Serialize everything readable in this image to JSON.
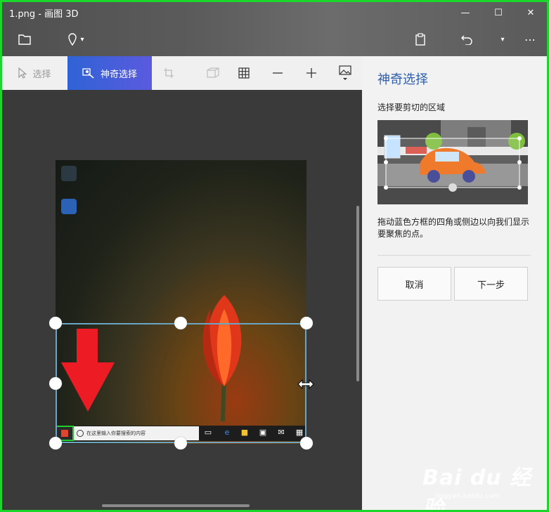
{
  "window": {
    "title": "1.png - 画图 3D",
    "controls": {
      "minimize_icon": "—",
      "maximize_icon": "☐",
      "close_icon": "✕"
    }
  },
  "appbar": {
    "folder_icon": "folder-icon",
    "pin_icon": "pin-icon",
    "pin_dropdown": "▾",
    "paste_icon": "paste-icon",
    "undo_icon": "undo-icon",
    "history_dropdown": "▾",
    "more": "⋯"
  },
  "toolbar": {
    "select_label": "选择",
    "magic_select_label": "神奇选择",
    "tools": [
      "crop-icon",
      "3d-view-icon",
      "grid-icon",
      "minus-icon",
      "plus-icon",
      "image-icon"
    ]
  },
  "canvas": {
    "taskbar_search_text": "在这里输入你要搜索的内容"
  },
  "panel": {
    "title": "神奇选择",
    "subtitle": "选择要剪切的区域",
    "description": "拖动蓝色方框的四角或侧边以向我们显示要聚焦的点。",
    "cancel_label": "取消",
    "next_label": "下一步"
  },
  "watermark": {
    "brand": "Bai du 经验",
    "url": "jingyan.baidu.com"
  },
  "colors": {
    "accent_blue": "#2f5faa",
    "magic_select_bg": "#3d5fe0",
    "selection_border": "#6aa6c4",
    "arrow_red": "#ed1c24",
    "outer_border_green": "#19d82b"
  }
}
